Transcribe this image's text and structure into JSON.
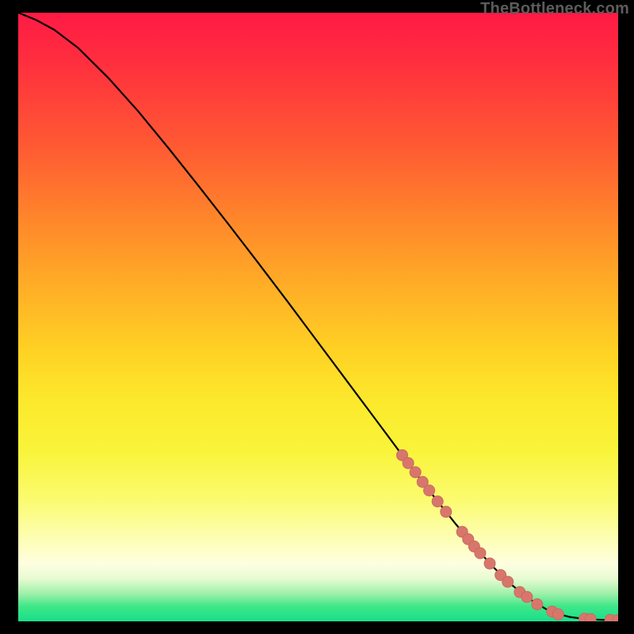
{
  "watermark": "TheBottleneck.com",
  "colors": {
    "background": "#000000",
    "line": "#000000",
    "marker_fill": "#d8766c",
    "marker_stroke": "#c96a60",
    "gradient_top": "#ff1a45",
    "gradient_bottom": "#18df8a"
  },
  "chart_data": {
    "type": "line",
    "title": "",
    "xlabel": "",
    "ylabel": "",
    "xlim": [
      0,
      100
    ],
    "ylim": [
      0,
      100
    ],
    "grid": false,
    "legend": false,
    "series": [
      {
        "name": "curve",
        "style": "line",
        "x": [
          0,
          3,
          6,
          10,
          15,
          20,
          25,
          30,
          35,
          40,
          45,
          50,
          55,
          60,
          64,
          67,
          70,
          73,
          76,
          79,
          82,
          85,
          88,
          90,
          92,
          94,
          96,
          98,
          100
        ],
        "y": [
          100,
          98.8,
          97.2,
          94.2,
          89.3,
          83.8,
          77.8,
          71.6,
          65.3,
          58.9,
          52.4,
          45.8,
          39.2,
          32.6,
          27.3,
          23.4,
          19.6,
          15.9,
          12.4,
          9.1,
          6.2,
          3.8,
          2.0,
          1.2,
          0.7,
          0.45,
          0.3,
          0.22,
          0.2
        ]
      },
      {
        "name": "markers",
        "style": "points",
        "points": [
          {
            "x": 64.0,
            "y": 27.3
          },
          {
            "x": 65.0,
            "y": 26.0
          },
          {
            "x": 66.2,
            "y": 24.5
          },
          {
            "x": 67.4,
            "y": 22.9
          },
          {
            "x": 68.5,
            "y": 21.5
          },
          {
            "x": 69.9,
            "y": 19.7
          },
          {
            "x": 71.3,
            "y": 18.0
          },
          {
            "x": 74.0,
            "y": 14.7
          },
          {
            "x": 75.0,
            "y": 13.5
          },
          {
            "x": 76.0,
            "y": 12.3
          },
          {
            "x": 77.0,
            "y": 11.2
          },
          {
            "x": 78.6,
            "y": 9.5
          },
          {
            "x": 80.4,
            "y": 7.6
          },
          {
            "x": 81.6,
            "y": 6.5
          },
          {
            "x": 83.6,
            "y": 4.8
          },
          {
            "x": 84.8,
            "y": 4.0
          },
          {
            "x": 86.5,
            "y": 2.8
          },
          {
            "x": 89.0,
            "y": 1.6
          },
          {
            "x": 90.0,
            "y": 1.15
          },
          {
            "x": 94.4,
            "y": 0.42
          },
          {
            "x": 95.4,
            "y": 0.35
          },
          {
            "x": 98.7,
            "y": 0.22
          },
          {
            "x": 100.0,
            "y": 0.2
          }
        ]
      }
    ]
  }
}
